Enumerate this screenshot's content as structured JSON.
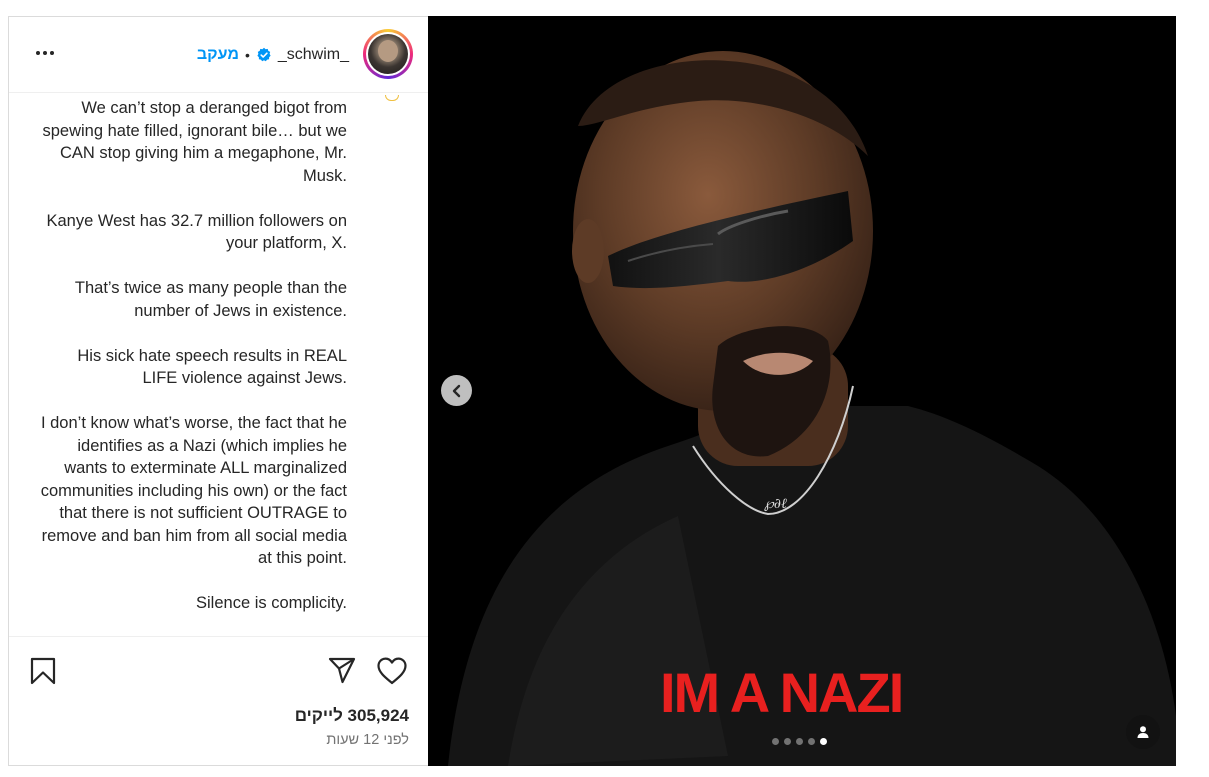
{
  "header": {
    "username": "_schwim_",
    "separator": "•",
    "follow_label": "מעקב",
    "verified_icon": "verified-badge-icon",
    "more_icon": "more-options-icon"
  },
  "caption": {
    "paragraphs": [
      "We can’t stop a deranged bigot from spewing hate filled, ignorant bile… but we CAN stop giving him a megaphone, Mr. Musk.",
      "Kanye West has 32.7 million followers on your platform, X.",
      "That’s twice as many people than the number of Jews in existence.",
      "His sick hate speech results in REAL LIFE violence against Jews.",
      "I don’t know what’s worse, the fact that he identifies as a Nazi (which implies he wants to exterminate ALL marginalized communities including his own) or the fact that there is not sufficient OUTRAGE to remove and ban him from all social media at this point.",
      "Silence is complicity."
    ]
  },
  "actions": {
    "likes_text": "305,924 לייקים",
    "time_text": "לפני 12 שעות",
    "icons": [
      "bookmark-icon",
      "share-icon",
      "heart-icon"
    ]
  },
  "media": {
    "shirt_text": "IM A NAZI",
    "carousel_count": 5,
    "carousel_active_index": 4,
    "icons": [
      "chevron-left-icon",
      "user-tag-icon"
    ]
  },
  "colors": {
    "follow_blue": "#0095f6",
    "shirt_text_red": "#e8201f",
    "media_background": "#000000"
  }
}
